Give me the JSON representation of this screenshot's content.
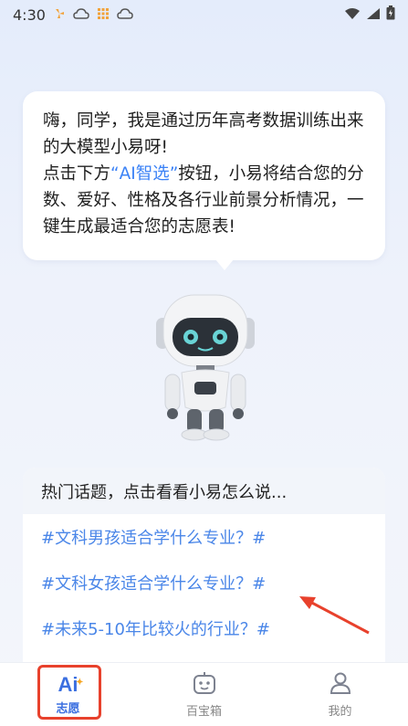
{
  "status_bar": {
    "time": "4:30",
    "icons": [
      "fan-icon",
      "cloud-icon",
      "grid-icon",
      "cloud-icon",
      "wifi-icon",
      "signal-icon",
      "battery-icon"
    ]
  },
  "bubble": {
    "line1": "嗨，同学，我是通过历年高考数据训练出来的大模型小易呀!",
    "line2_prefix": "点击下方",
    "line2_highlight": "“AI智选”",
    "line2_suffix": "按钮，小易将结合您的分数、爱好、性格及各行业前景分析情况，一键生成最适合您的志愿表!"
  },
  "topics": {
    "header": "热门话题，点击看看小易怎么说...",
    "items": [
      "#文科男孩适合学什么专业？#",
      "#文科女孩适合学什么专业？#",
      "#未来5-10年比较火的行业？#"
    ]
  },
  "tabbar": {
    "tabs": [
      {
        "label": "志愿",
        "icon": "ai-icon"
      },
      {
        "label": "百宝箱",
        "icon": "robot-box-icon"
      },
      {
        "label": "我的",
        "icon": "user-icon"
      }
    ]
  },
  "colors": {
    "accent": "#3b6fe0",
    "topic_link": "#4a86e8",
    "annotation_red": "#e8412c"
  }
}
